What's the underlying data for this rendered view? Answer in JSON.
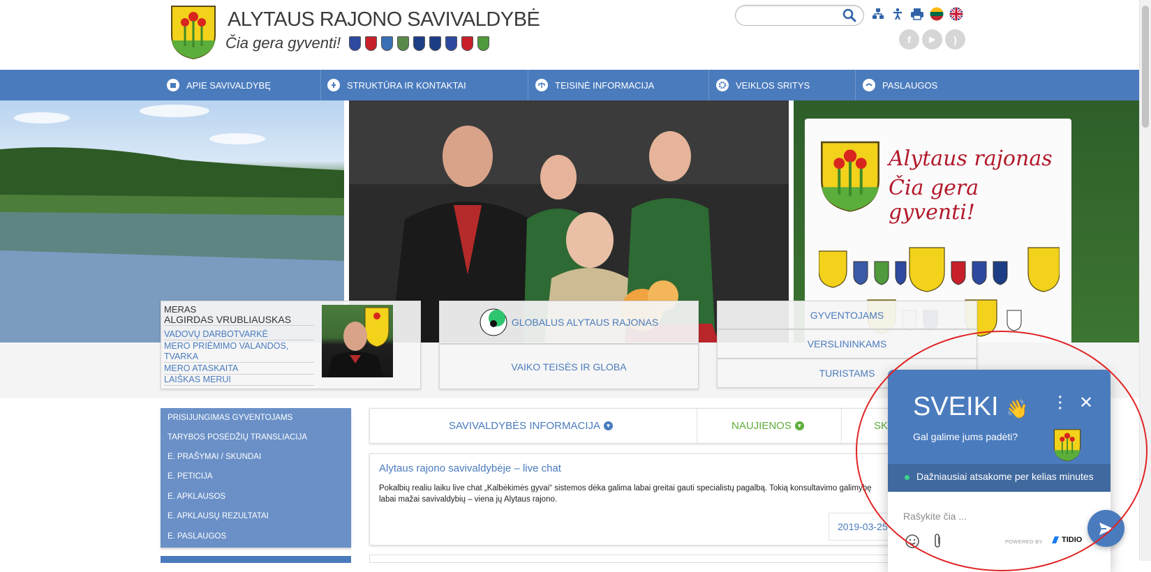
{
  "header": {
    "title": "ALYTAUS RAJONO SAVIVALDYBĖ",
    "motto": "Čia gera gyventi!",
    "mini_crest_colors": [
      "#2d4aa0",
      "#c8202a",
      "#3a6fb5",
      "#5a8a4a",
      "#1d3e86",
      "#1d3e86",
      "#2d4aa0",
      "#c8202a",
      "#4f9a3c"
    ],
    "search": {
      "placeholder": "",
      "value": ""
    },
    "top_icons": [
      "sitemap-icon",
      "accessibility-icon",
      "print-icon",
      "lithuanian-flag-icon",
      "uk-flag-icon"
    ],
    "social": [
      {
        "name": "facebook-icon",
        "glyph": "f"
      },
      {
        "name": "youtube-icon",
        "glyph": "▶"
      },
      {
        "name": "rss-icon",
        "glyph": ")"
      }
    ]
  },
  "nav": {
    "items": [
      {
        "label": "APIE SAVIVALDYBĘ",
        "icon": "building-icon"
      },
      {
        "label": "STRUKTŪRA IR KONTAKTAI",
        "icon": "structure-icon"
      },
      {
        "label": "TEISINĖ INFORMACIJA",
        "icon": "scales-icon"
      },
      {
        "label": "VEIKLOS SRITYS",
        "icon": "gear-icon"
      },
      {
        "label": "PASLAUGOS",
        "icon": "services-icon"
      }
    ]
  },
  "hero": {
    "banner_line1": "Alytaus rajonas",
    "banner_line2": "Čia gera gyventi!"
  },
  "mayor": {
    "role": "MERAS",
    "name": "ALGIRDAS VRUBLIAUSKAS",
    "links": [
      "VADOVŲ DARBOTVARKĖ",
      "MERO PRIĖMIMO VALANDOS,",
      "TVARKA",
      "MERO ATASKAITA",
      "LAIŠKAS MERUI"
    ]
  },
  "center_links": {
    "global": "GLOBALUS ALYTAUS RAJONAS",
    "child": "VAIKO TEISĖS IR GLOBA"
  },
  "audience_links": [
    "GYVENTOJAMS",
    "VERSLININKAMS",
    "TURISTAMS"
  ],
  "sidebar": {
    "items": [
      "PRISIJUNGIMAS GYVENTOJAMS",
      "TARYBOS POSĖDŽIŲ TRANSLIACIJA",
      "E. PRAŠYMAI / SKUNDAI",
      "E. PETICIJA",
      "E. APKLAUSOS",
      "E. APKLAUSŲ REZULTATAI",
      "E. PASLAUGOS"
    ]
  },
  "tabs": {
    "info": "SAVIVALDYBĖS INFORMACIJA",
    "news": "NAUJIENOS",
    "partial": "SK",
    "info_color": "#4a7bbd",
    "news_color": "#5fae3c"
  },
  "news": {
    "title": "Alytaus rajono savivaldybėje – live chat",
    "body_line1": "Pokalbių realiu laiku live chat „Kalbėkimės gyvai“ sistemos dėka galima labai greitai gauti specialistų pagalbą. Tokią konsultavimo galimybę",
    "body_line2": "labai mažai savivaldybių – viena jų Alytaus rajono.",
    "date": "2019-03-25"
  },
  "chat": {
    "title": "SVEIKI",
    "wave_emoji": "👋",
    "subtitle": "Gal galime jums padėti?",
    "status": "Dažniausiai atsakome per kelias minutes",
    "input_placeholder": "Rašykite čia ...",
    "powered_by": "POWERED BY",
    "brand": "TIDIO"
  },
  "colors": {
    "primary": "#4a7bbd",
    "sidebar": "#6a90c7",
    "annotation": "#e02424"
  }
}
